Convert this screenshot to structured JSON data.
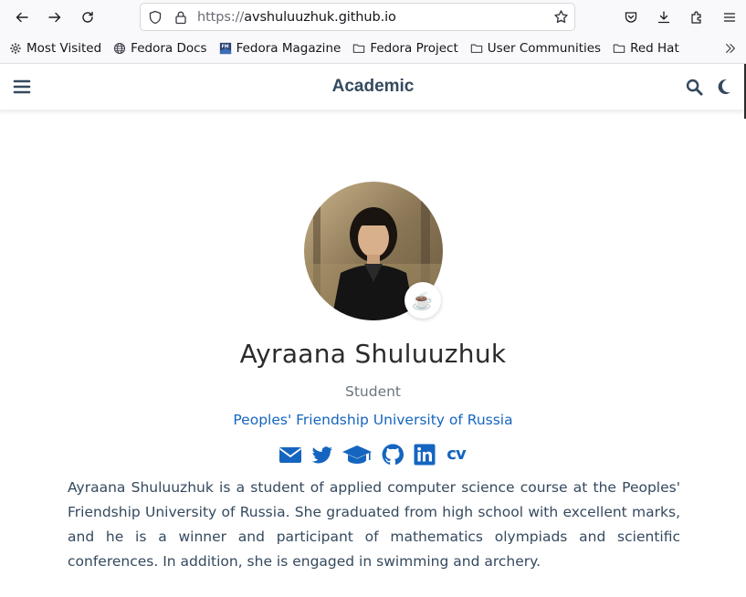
{
  "browser": {
    "url_protocol": "https://",
    "url_host": "avshuluuzhuk.github.io",
    "bookmarks": [
      {
        "label": "Most Visited",
        "icon": "gear-icon"
      },
      {
        "label": "Fedora Docs",
        "icon": "globe-icon"
      },
      {
        "label": "Fedora Magazine",
        "icon": "fedora-magazine-icon"
      },
      {
        "label": "Fedora Project",
        "icon": "folder-icon"
      },
      {
        "label": "User Communities",
        "icon": "folder-icon"
      },
      {
        "label": "Red Hat",
        "icon": "folder-icon"
      }
    ]
  },
  "site": {
    "title": "Academic"
  },
  "profile": {
    "status_emoji": "☕️",
    "name": "Ayraana Shuluuzhuk",
    "role": "Student",
    "organization": "Peoples' Friendship University of Russia",
    "cv_label": "cv",
    "bio": "Ayraana Shuluuzhuk is a student of applied computer science course at the Peoples' Friendship University of Russia. She graduated from high school with excellent marks, and he is a winner and participant of mathematics olympiads and scientific conferences. In addition, she is engaged in swimming and archery."
  },
  "colors": {
    "accent": "#1565c0",
    "nav_text": "#34495e"
  }
}
